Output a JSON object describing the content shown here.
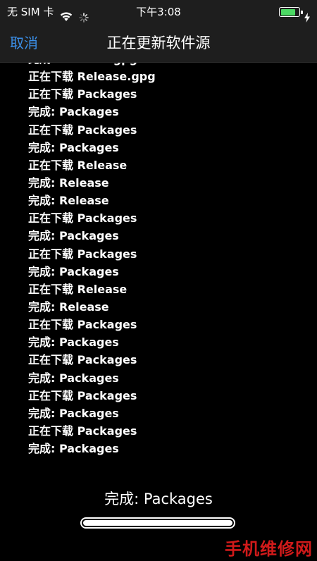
{
  "status_bar": {
    "carrier": "无 SIM 卡",
    "time": "下午3:08",
    "battery_level": 0.85,
    "battery_color": "#4cd964",
    "icons": [
      "wifi-icon",
      "spinner-icon",
      "battery-icon",
      "charge-icon"
    ]
  },
  "nav": {
    "cancel_label": "取消",
    "title": "正在更新软件源",
    "accent_color": "#3b8fe8"
  },
  "log": [
    "完成: Release.gpg",
    "正在下载 Release.gpg",
    "正在下载 Packages",
    "完成: Packages",
    "正在下载 Packages",
    "完成: Packages",
    "正在下载 Release",
    "完成: Release",
    "完成: Release",
    "正在下载 Packages",
    "完成: Packages",
    "正在下载 Packages",
    "完成: Packages",
    "正在下载 Release",
    "完成: Release",
    "正在下载 Packages",
    "完成: Packages",
    "正在下载 Packages",
    "完成: Packages",
    "正在下载 Packages",
    "完成: Packages",
    "正在下载 Packages",
    "完成: Packages"
  ],
  "current_status": "完成: Packages",
  "progress": 1.0,
  "watermark": "手机维修网"
}
